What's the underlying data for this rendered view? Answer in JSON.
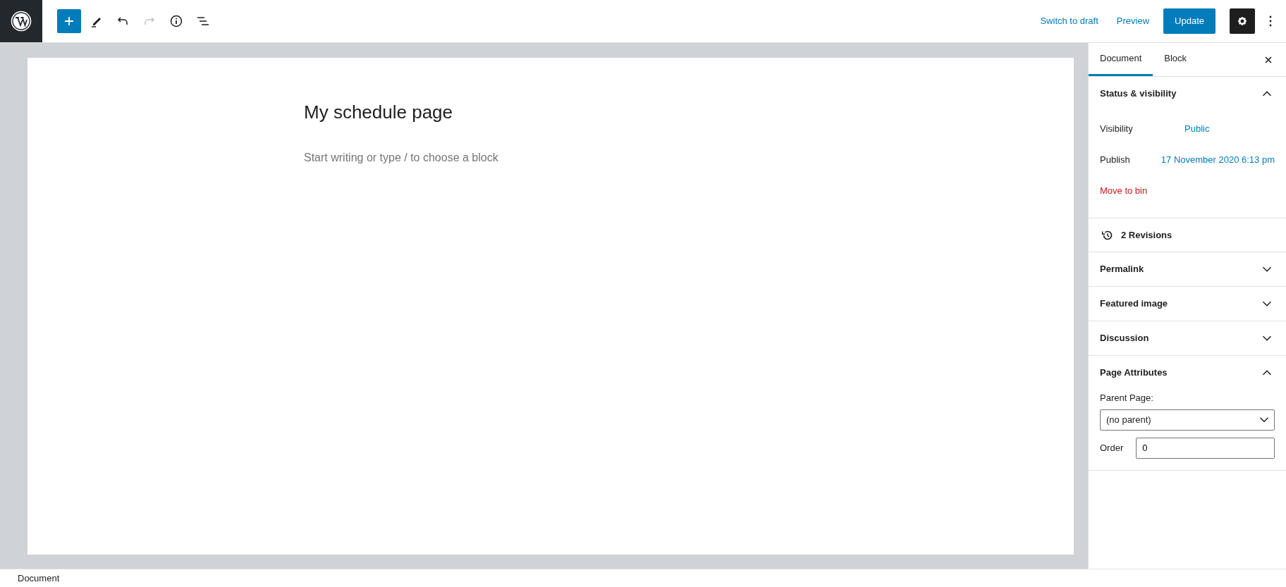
{
  "toolbar": {
    "redo": {
      "disabled": true
    }
  },
  "header_actions": {
    "switch_to_draft": "Switch to draft",
    "preview": "Preview",
    "update": "Update",
    "settings": {
      "selected": true
    }
  },
  "editor": {
    "title": "My schedule page",
    "placeholder": "Start writing or type / to choose a block"
  },
  "sidebar": {
    "tabs": [
      {
        "label": "Document",
        "selected": true
      },
      {
        "label": "Block",
        "selected": false
      }
    ],
    "panels": [
      {
        "kind": "section",
        "title": "Status & visibility",
        "expanded": true,
        "rows": [
          {
            "label": "Visibility",
            "value": "Public"
          },
          {
            "label": "Publish",
            "value": "17 November 2020 6:13 pm"
          }
        ],
        "danger_link": "Move to bin"
      },
      {
        "kind": "revisions",
        "title": "2 Revisions"
      },
      {
        "kind": "section",
        "title": "Permalink",
        "expanded": false
      },
      {
        "kind": "section",
        "title": "Featured image",
        "expanded": false
      },
      {
        "kind": "section",
        "title": "Discussion",
        "expanded": false
      },
      {
        "kind": "section",
        "title": "Page Attributes",
        "expanded": true,
        "parent_label": "Parent Page:",
        "parent_value": "(no parent)",
        "order_label": "Order",
        "order_value": "0"
      }
    ]
  },
  "status_bar": {
    "breadcrumb": "Document"
  }
}
